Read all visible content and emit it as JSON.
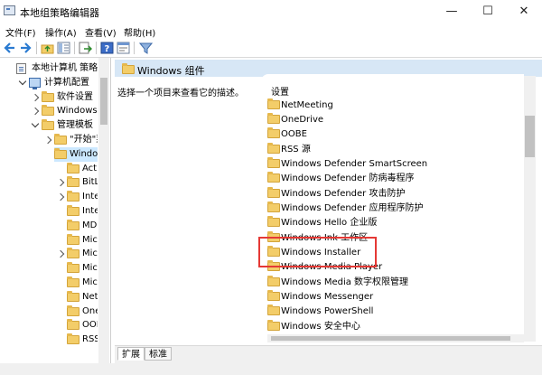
{
  "window": {
    "title": "本地组策略编辑器",
    "minimize_glyph": "—",
    "maximize_glyph": "☐",
    "close_glyph": "✕"
  },
  "menu": [
    {
      "label": "文件(F)"
    },
    {
      "label": "操作(A)"
    },
    {
      "label": "查看(V)"
    },
    {
      "label": "帮助(H)"
    }
  ],
  "toolbar": {
    "icons": [
      "back-arrow-icon",
      "forward-arrow-icon",
      "up-folder-icon",
      "show-hide-tree-icon",
      "export-list-icon",
      "help-icon",
      "properties-icon",
      "filter-icon"
    ]
  },
  "tree": {
    "items": [
      {
        "label": "本地计算机 策略",
        "depth": 0,
        "expander": "none",
        "icon": "doc",
        "selected": false
      },
      {
        "label": "计算机配置",
        "depth": 1,
        "expander": "open",
        "icon": "pc",
        "selected": false
      },
      {
        "label": "软件设置",
        "depth": 2,
        "expander": "closed",
        "icon": "folder",
        "selected": false
      },
      {
        "label": "Windows 设置",
        "depth": 2,
        "expander": "closed",
        "icon": "folder",
        "selected": false
      },
      {
        "label": "管理模板",
        "depth": 2,
        "expander": "open",
        "icon": "folder",
        "selected": false
      },
      {
        "label": "\"开始\"菜单",
        "depth": 3,
        "expander": "closed",
        "icon": "folder",
        "selected": false
      },
      {
        "label": "Windows 组件",
        "depth": 3,
        "expander": "open",
        "icon": "folder",
        "selected": true
      },
      {
        "label": "ActiveX",
        "depth": 4,
        "expander": "none",
        "icon": "folder",
        "selected": false
      },
      {
        "label": "BitLocker",
        "depth": 4,
        "expander": "closed",
        "icon": "folder",
        "selected": false
      },
      {
        "label": "Internet",
        "depth": 4,
        "expander": "closed",
        "icon": "folder",
        "selected": false
      },
      {
        "label": "Internet",
        "depth": 4,
        "expander": "none",
        "icon": "folder",
        "selected": false
      },
      {
        "label": "MDM",
        "depth": 4,
        "expander": "none",
        "icon": "folder",
        "selected": false
      },
      {
        "label": "Microsoft",
        "depth": 4,
        "expander": "none",
        "icon": "folder",
        "selected": false
      },
      {
        "label": "Microsoft",
        "depth": 4,
        "expander": "closed",
        "icon": "folder",
        "selected": false
      },
      {
        "label": "Microsoft",
        "depth": 4,
        "expander": "none",
        "icon": "folder",
        "selected": false
      },
      {
        "label": "Microsoft",
        "depth": 4,
        "expander": "none",
        "icon": "folder",
        "selected": false
      },
      {
        "label": "NetMeeting",
        "depth": 4,
        "expander": "none",
        "icon": "folder",
        "selected": false
      },
      {
        "label": "OneDrive",
        "depth": 4,
        "expander": "none",
        "icon": "folder",
        "selected": false
      },
      {
        "label": "OOBE",
        "depth": 4,
        "expander": "none",
        "icon": "folder",
        "selected": false
      },
      {
        "label": "RSS 源",
        "depth": 4,
        "expander": "none",
        "icon": "folder",
        "selected": false
      }
    ]
  },
  "details": {
    "header": "Windows 组件",
    "description": "选择一个项目来查看它的描述。",
    "column_header": "设置",
    "items": [
      "NetMeeting",
      "OneDrive",
      "OOBE",
      "RSS 源",
      "Windows Defender SmartScreen",
      "Windows Defender 防病毒程序",
      "Windows Defender 攻击防护",
      "Windows Defender 应用程序防护",
      "Windows Hello 企业版",
      "Windows Ink 工作区",
      "Windows Installer",
      "Windows Media Player",
      "Windows Media 数字权限管理",
      "Windows Messenger",
      "Windows PowerShell",
      "Windows 安全中心"
    ],
    "highlighted_item": "Windows Installer",
    "highlight_color": "#e53935"
  },
  "tabs": [
    {
      "label": "扩展",
      "active": true
    },
    {
      "label": "标准",
      "active": false
    }
  ]
}
